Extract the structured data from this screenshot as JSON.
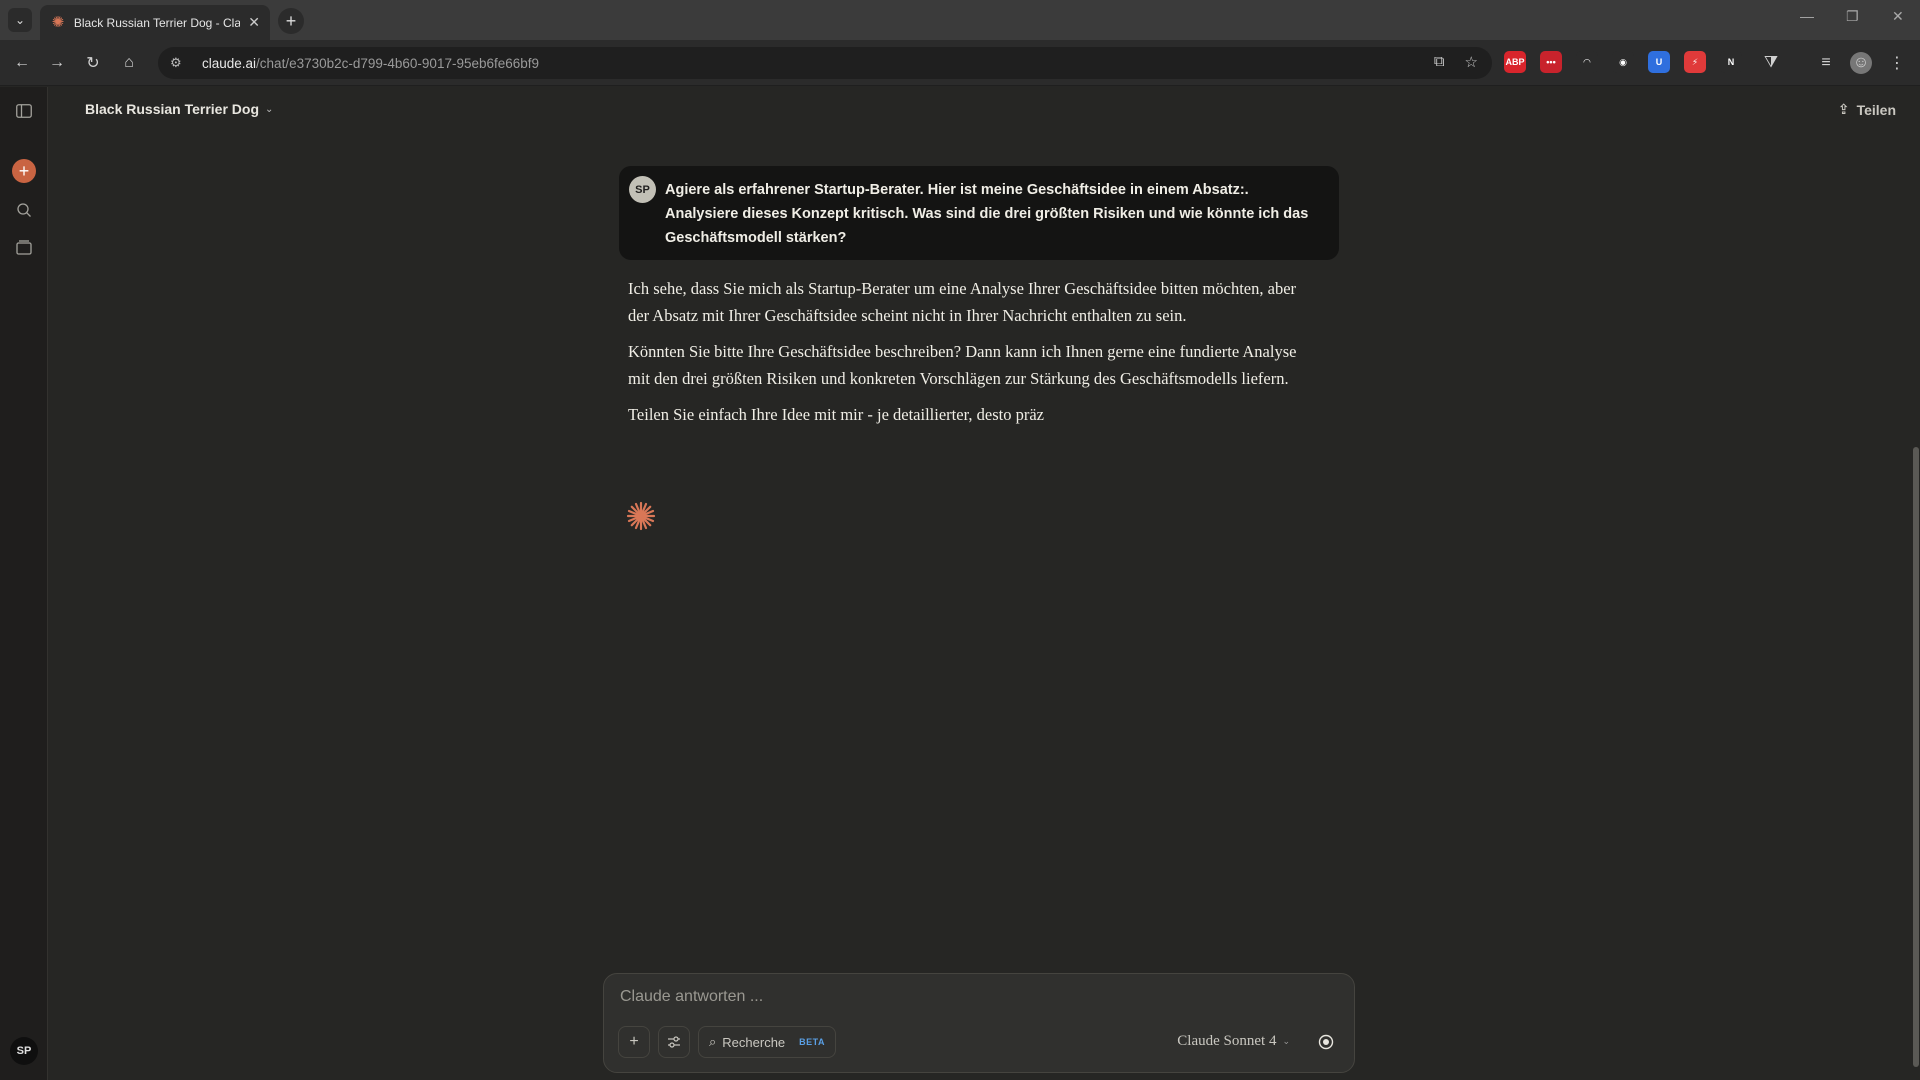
{
  "browser": {
    "tab_title": "Black Russian Terrier Dog - Claude",
    "url_host": "claude.ai",
    "url_path": "/chat/e3730b2c-d799-4b60-9017-95eb6fe66bf9",
    "extensions": [
      {
        "label": "ABP",
        "color": "#d9252c"
      },
      {
        "label": "•••",
        "color": "#c8232c"
      },
      {
        "label": "◠",
        "color": "#2b2b2b"
      },
      {
        "label": "◉",
        "color": "#2b2b2b"
      },
      {
        "label": "U",
        "color": "#2f6fde"
      },
      {
        "label": "⚡",
        "color": "#e03a3a"
      },
      {
        "label": "N",
        "color": "#2b2b2b"
      }
    ]
  },
  "header": {
    "chat_title": "Black Russian Terrier Dog",
    "share_label": "Teilen"
  },
  "sidebar": {
    "user_initials": "SP"
  },
  "user_message": {
    "initials": "SP",
    "text": "Agiere als erfahrener Startup-Berater. Hier ist meine Geschäftsidee in einem Absatz:. Analysiere dieses Konzept kritisch. Was sind die drei größten Risiken und wie könnte ich das Geschäftsmodell stärken?"
  },
  "assistant_message": {
    "paragraphs": [
      "Ich sehe, dass Sie mich als Startup-Berater um eine Analyse Ihrer Geschäftsidee bitten möchten, aber der Absatz mit Ihrer Geschäftsidee scheint nicht in Ihrer Nachricht enthalten zu sein.",
      "Könnten Sie bitte Ihre Geschäftsidee beschreiben? Dann kann ich Ihnen gerne eine fundierte Analyse mit den drei größten Risiken und konkreten Vorschlägen zur Stärkung des Geschäftsmodells liefern.",
      "Teilen Sie einfach Ihre Idee mit mir - je detaillierter, desto präz"
    ]
  },
  "composer": {
    "placeholder": "Claude antworten ...",
    "research_label": "Recherche",
    "beta_label": "BETA",
    "model_label": "Claude Sonnet 4"
  },
  "colors": {
    "accent": "#c96442",
    "background": "#262624"
  }
}
